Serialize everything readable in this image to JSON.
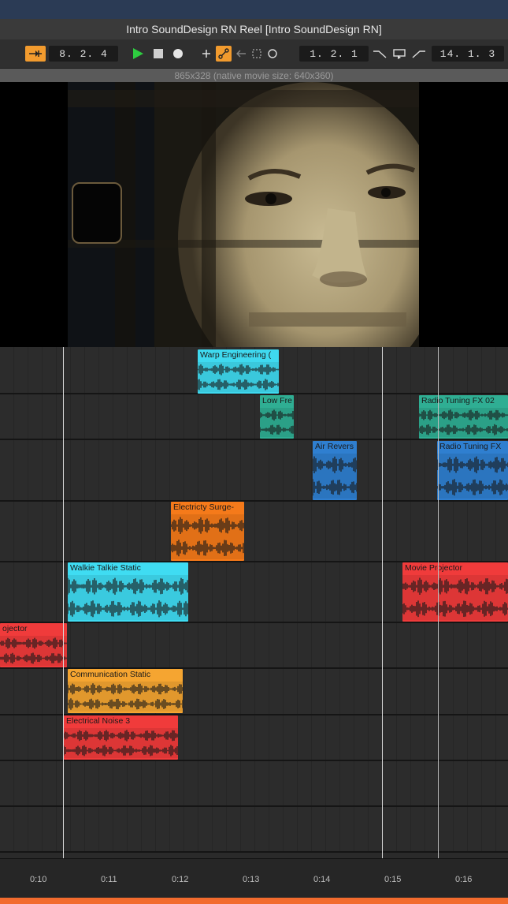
{
  "window": {
    "title": "Intro SoundDesign RN Reel  [Intro SoundDesign RN]"
  },
  "toolbar": {
    "left_position": "8. 2. 4",
    "loop_start": "1. 2. 1",
    "loop_length": "14. 1. 3"
  },
  "video": {
    "info": "865x328 (native movie size: 640x360)"
  },
  "clips": [
    {
      "name": "Warp Engineering (",
      "color": "#3fd9ef"
    },
    {
      "name": "Low Fre",
      "color": "#2fae93"
    },
    {
      "name": "Radio Tuning FX 02",
      "color": "#2fae93"
    },
    {
      "name": "Air Revers",
      "color": "#2f7fd0"
    },
    {
      "name": "Radio Tuning FX",
      "color": "#2f7fd0"
    },
    {
      "name": "Electricty Surge-",
      "color": "#f57a1a"
    },
    {
      "name": "Walkie Talkie Static",
      "color": "#3fdcf2"
    },
    {
      "name": "Movie Projector",
      "color": "#f03b3b"
    },
    {
      "name": "ojector",
      "color": "#f03b3b"
    },
    {
      "name": "Communication Static",
      "color": "#f5a531"
    },
    {
      "name": "Electrical Noise 3",
      "color": "#f03b3b"
    }
  ],
  "ruler": {
    "ticks": [
      "0:10",
      "0:11",
      "0:12",
      "0:13",
      "0:14",
      "0:15",
      "0:16"
    ]
  },
  "colors": {
    "accent": "#f29b2e",
    "play": "#2ecc40",
    "bottom_bar": "#f26b2e"
  }
}
